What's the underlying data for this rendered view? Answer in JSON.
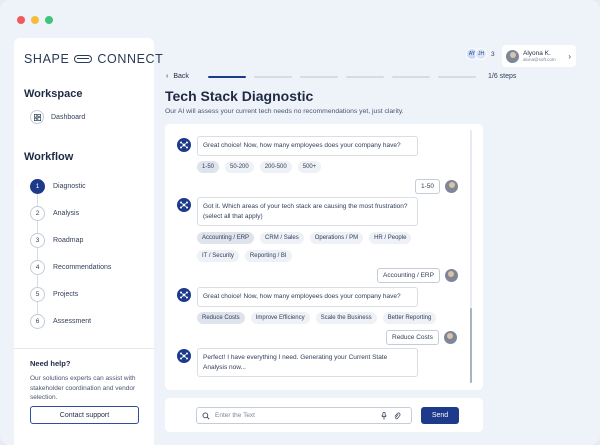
{
  "app": {
    "logo_left": "SHAPE",
    "logo_right": "CONNECT"
  },
  "sidebar": {
    "workspace_title": "Workspace",
    "dashboard_label": "Dashboard",
    "workflow_title": "Workflow",
    "steps": [
      {
        "num": "1",
        "label": "Diagnostic",
        "active": true
      },
      {
        "num": "2",
        "label": "Analysis",
        "active": false
      },
      {
        "num": "3",
        "label": "Roadmap",
        "active": false
      },
      {
        "num": "4",
        "label": "Recommendations",
        "active": false
      },
      {
        "num": "5",
        "label": "Projects",
        "active": false
      },
      {
        "num": "6",
        "label": "Assessment",
        "active": false
      }
    ],
    "help_title": "Need help?",
    "help_text": "Our solutions experts can assist with stakeholder coordination and vendor selection.",
    "support_button": "Contact support"
  },
  "header": {
    "collaborators": [
      "AY",
      "JH"
    ],
    "collaborator_count": "3",
    "user_name": "Alyona K.",
    "user_email": "alona@soft.com"
  },
  "main": {
    "back_label": "Back",
    "step_count": "1/6 steps",
    "progress_completed": 1,
    "progress_total": 6,
    "title": "Tech Stack Diagnostic",
    "subtitle": "Our AI will assess your current tech needs  no recommendations yet, just clarity."
  },
  "chat": {
    "q1": "Great choice! Now, how many employees does your company have?",
    "q1_options": [
      "1-50",
      "50-200",
      "200-500",
      "500+"
    ],
    "a1": "1-50",
    "q2": "Got it. Which areas of your tech stack are causing the most frustration? (select all that apply)",
    "q2_options_row1": [
      "Accounting / ERP",
      "CRM / Sales",
      "Operations / PM",
      "HR / People"
    ],
    "q2_options_row2": [
      "IT / Security",
      "Reporting / BI"
    ],
    "a2": "Accounting / ERP",
    "q3": "Great choice! Now, how many employees does your company have?",
    "q3_options": [
      "Reduce Costs",
      "Improve Efficiency",
      "Scale the Business",
      "Better Reporting"
    ],
    "a3": "Reduce Costs",
    "q4": "Perfect! I have everything I need. Generating your Current State Analysis now..."
  },
  "composer": {
    "placeholder": "Enter the Text",
    "send_label": "Send"
  },
  "colors": {
    "accent": "#1e3a8a",
    "background": "#eef2f9"
  }
}
